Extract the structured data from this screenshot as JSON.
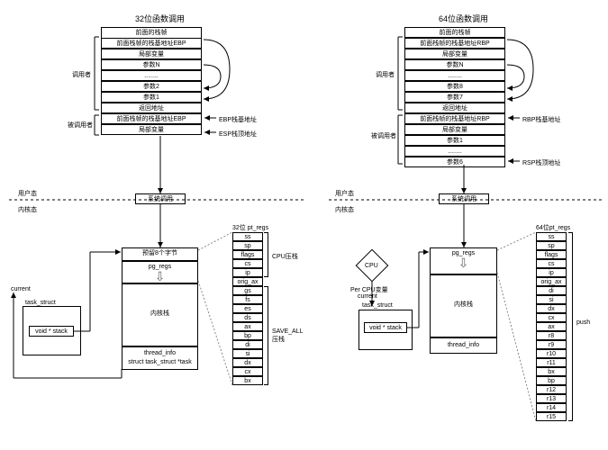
{
  "left": {
    "title": "32位函数调用",
    "caller": "调用者",
    "callee": "被调用者",
    "stack1": [
      "前面的栈帧",
      "前面栈帧的栈基地址EBP",
      "局部变量",
      "参数N",
      "........",
      "参数2",
      "参数1",
      "返回地址",
      "前面栈帧的栈基地址EBP",
      "局部变量"
    ],
    "ebp_note": "EBP栈基地址",
    "esp_note": "ESP栈顶地址",
    "user": "用户态",
    "kernel": "内核态",
    "syscall": "系统调用",
    "reserve": "预留8个字节",
    "pg_regs": "pg_regs",
    "kstack": "内核栈",
    "thread": "thread_info\nstruct task_struct *task",
    "current": "current",
    "task_struct": "task_struct",
    "voidstack": "void * stack",
    "pt_title": "32位 pt_regs",
    "pt_regs": [
      "ss",
      "sp",
      "flags",
      "cs",
      "ip",
      "orig_ax",
      "gs",
      "fs",
      "es",
      "ds",
      "ax",
      "bp",
      "di",
      "si",
      "dx",
      "cx",
      "bx"
    ],
    "cpu_push": "CPU压栈",
    "save_all": "SAVE_ALL 压栈"
  },
  "right": {
    "title": "64位函数调用",
    "caller": "调用者",
    "callee": "被调用者",
    "stack1": [
      "前面的栈帧",
      "前面栈帧的栈基地址RBP",
      "局部变量",
      "参数N",
      "........",
      "参数8",
      "参数7",
      "返回地址",
      "前面栈帧的栈基地址RBP",
      "局部变量",
      "参数1",
      "........",
      "参数6"
    ],
    "rbp_note": "RBP栈基地址",
    "rsp_note": "RSP栈顶地址",
    "user": "用户态",
    "kernel": "内核态",
    "syscall": "系统调用",
    "pg_regs": "pg_regs",
    "kstack": "内核栈",
    "thread": "thread_info",
    "cpu": "CPU",
    "percpu": "Per CPU变量",
    "current": "current",
    "task_struct": "task_struct",
    "voidstack": "void * stack",
    "pt_title": "64位pt_regs",
    "pt_regs": [
      "ss",
      "sp",
      "flags",
      "cs",
      "ip",
      "orig_ax",
      "di",
      "si",
      "dx",
      "cx",
      "ax",
      "r8",
      "r9",
      "r10",
      "r11",
      "bx",
      "bp",
      "r12",
      "r13",
      "r14",
      "r15"
    ],
    "push": "push"
  }
}
